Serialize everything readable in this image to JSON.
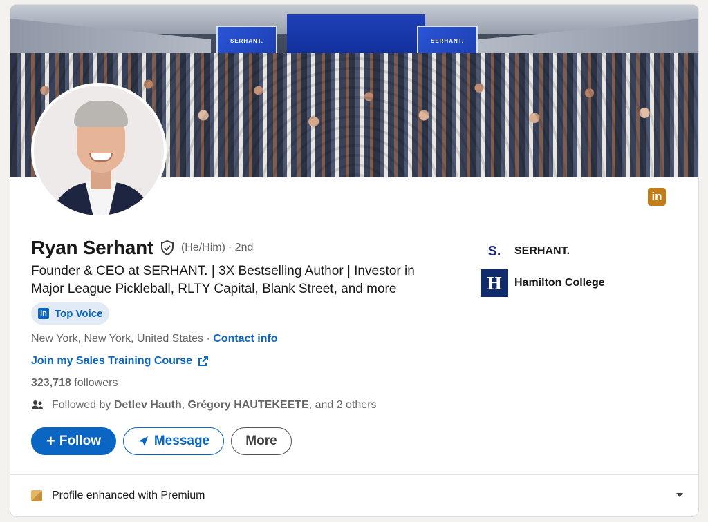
{
  "banner": {
    "screen_text": "SERHANT."
  },
  "profile": {
    "name": "Ryan Serhant",
    "pronouns": "(He/Him)",
    "degree": "· 2nd",
    "headline": "Founder & CEO at SERHANT. | 3X Bestselling Author | Investor in Major League Pickleball, RLTY Capital, Blank Street, and more",
    "top_voice_label": "Top Voice",
    "location": "New York, New York, United States · ",
    "contact_info": "Contact info",
    "course_link": "Join my Sales Training Course",
    "followers_count": "323,718",
    "followers_label": " followers",
    "followed_by_prefix": "Followed by ",
    "followed_by_name1": "Detlev Hauth",
    "followed_by_sep": ", ",
    "followed_by_name2": "Grégory HAUTEKEETE",
    "followed_by_suffix": ", and 2 others"
  },
  "actions": {
    "follow_label": "Follow",
    "message_label": "Message",
    "more_label": "More"
  },
  "companies": [
    {
      "logo_text": "S.",
      "name": "SERHANT."
    },
    {
      "logo_text": "H",
      "name": "Hamilton College"
    }
  ],
  "linkedin_badge": "in",
  "premium": {
    "label": "Profile enhanced with Premium"
  },
  "colors": {
    "accent": "#0a66c2",
    "premium_gold": "#c37d16",
    "background": "#f4f2ee"
  },
  "icons": [
    "verified-shield-icon",
    "linkedin-icon",
    "external-link-icon",
    "people-icon",
    "plus-icon",
    "send-icon",
    "premium-icon",
    "caret-down-icon"
  ]
}
